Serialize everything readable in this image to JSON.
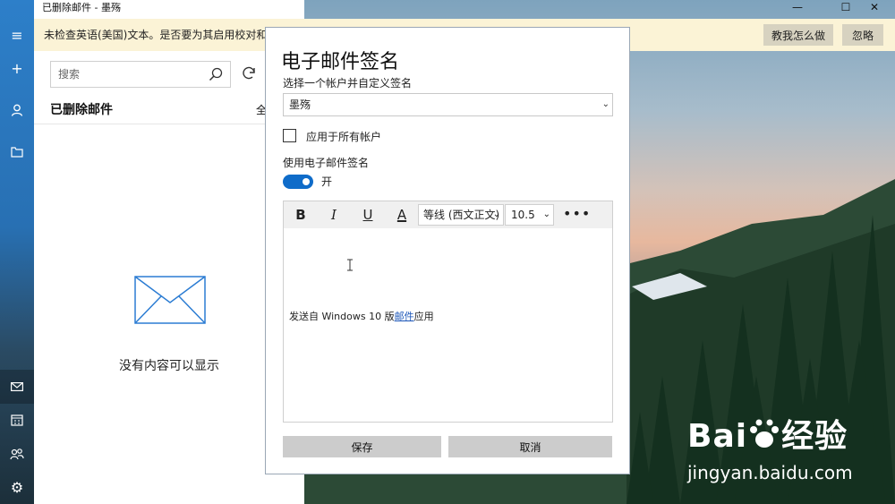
{
  "window": {
    "title": "已删除邮件 - 墨殇",
    "controls": [
      "—",
      "☐",
      "✕"
    ]
  },
  "notification": {
    "message": "未检查英语(美国)文本。是否要为其启用校对和翻",
    "teach_button": "教我怎么做",
    "ignore_button": "忽略"
  },
  "list": {
    "search_placeholder": "搜索",
    "folder_title": "已删除邮件",
    "filter_label": "全",
    "empty_message": "没有内容可以显示"
  },
  "dialog": {
    "title": "电子邮件签名",
    "account_prompt": "选择一个帐户并自定义签名",
    "account_value": "墨殇",
    "apply_all_label": "应用于所有帐户",
    "use_signature_label": "使用电子邮件签名",
    "toggle_state": "开",
    "toolbar": {
      "bold": "B",
      "italic": "I",
      "underline": "U",
      "font_color": "A",
      "font_name": "等线 (西文正文)",
      "font_size": "10.5",
      "more": "•••"
    },
    "signature": {
      "prefix": "发送自 Windows 10 版",
      "link": "邮件",
      "suffix": "应用"
    },
    "save_button": "保存",
    "cancel_button": "取消"
  },
  "watermark": {
    "brand": "Bai",
    "brand_suffix": "经验",
    "url": "jingyan.baidu.com"
  },
  "colors": {
    "accent": "#0f6cc9",
    "rail_top": "#2d7fc9",
    "notify_bg": "#fbf3d6"
  }
}
